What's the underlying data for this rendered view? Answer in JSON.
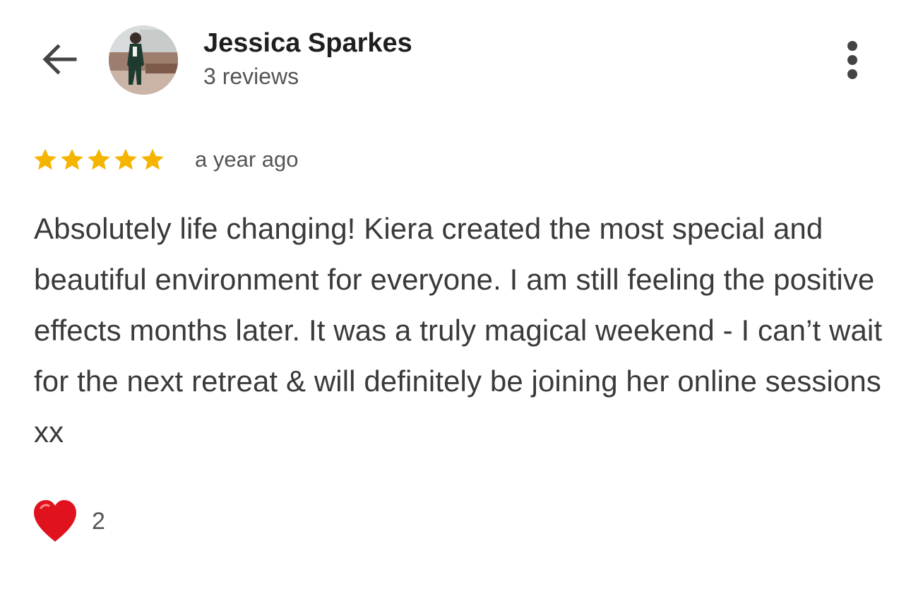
{
  "header": {
    "back_icon": "arrow-left-icon",
    "reviewer_name": "Jessica Sparkes",
    "review_count": "3 reviews",
    "more_icon": "more-vert-icon"
  },
  "review": {
    "rating": 5,
    "rating_max": 5,
    "star_color": "#f4b400",
    "date": "a year ago",
    "text": "Absolutely life changing! Kiera created the most special and beautiful environment for everyone. I am still feeling the positive effects months later. It was a truly magical weekend - I can’t wait for the next retreat & will definitely be joining her online sessions xx"
  },
  "reactions": {
    "icon": "heart-icon",
    "count": "2",
    "color": "#e0121e"
  }
}
